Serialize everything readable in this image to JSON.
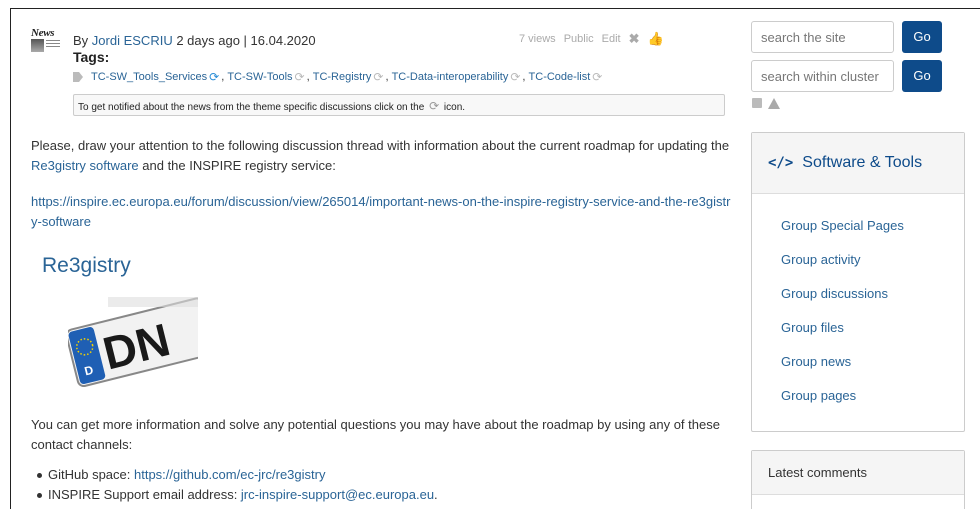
{
  "news_badge": "News",
  "byline": {
    "prefix": "By ",
    "author": "Jordi ESCRIU",
    "suffix": " 2 days ago | 16.04.2020"
  },
  "meta": {
    "views": "7 views",
    "visibility": "Public",
    "edit": "Edit"
  },
  "tags": {
    "title": "Tags:",
    "items": [
      "TC-SW_Tools_Services",
      "TC-SW-Tools",
      "TC-Registry",
      "TC-Data-interoperability",
      "TC-Code-list"
    ],
    "notify_before": "To get notified about the news from the theme specific discussions click on the",
    "notify_after": "icon."
  },
  "article": {
    "p1_before": "Please, draw your attention to the following discussion thread with information about the current roadmap for updating the ",
    "p1_link": "Re3gistry software",
    "p1_after": " and the INSPIRE registry service:",
    "link_url": "https://inspire.ec.europa.eu/forum/discussion/view/265014/important-news-on-the-inspire-registry-service-and-the-re3gistry-software",
    "heading": "Re3gistry",
    "p3": "You can get more information and solve any potential questions you may have about the roadmap by using any of these contact channels:",
    "bullets": [
      {
        "label": "GitHub space: ",
        "link": "https://github.com/ec-jrc/re3gistry",
        "after": ""
      },
      {
        "label": "INSPIRE Support email address: ",
        "link": "jrc-inspire-support@ec.europa.eu",
        "after": "."
      }
    ]
  },
  "plate": {
    "top_text": "DN",
    "badge": "D"
  },
  "sidebar": {
    "search_site": {
      "placeholder": "search the site",
      "button": "Go"
    },
    "search_cluster": {
      "placeholder": "search within cluster",
      "button": "Go"
    },
    "tools_title": "Software & Tools",
    "group_links": [
      "Group Special Pages",
      "Group activity",
      "Group discussions",
      "Group files",
      "Group news",
      "Group pages"
    ],
    "latest_comments": "Latest comments"
  },
  "colors": {
    "link": "#2a6496",
    "button": "#0e4b8a",
    "sync_active": "#2a8dd6"
  }
}
